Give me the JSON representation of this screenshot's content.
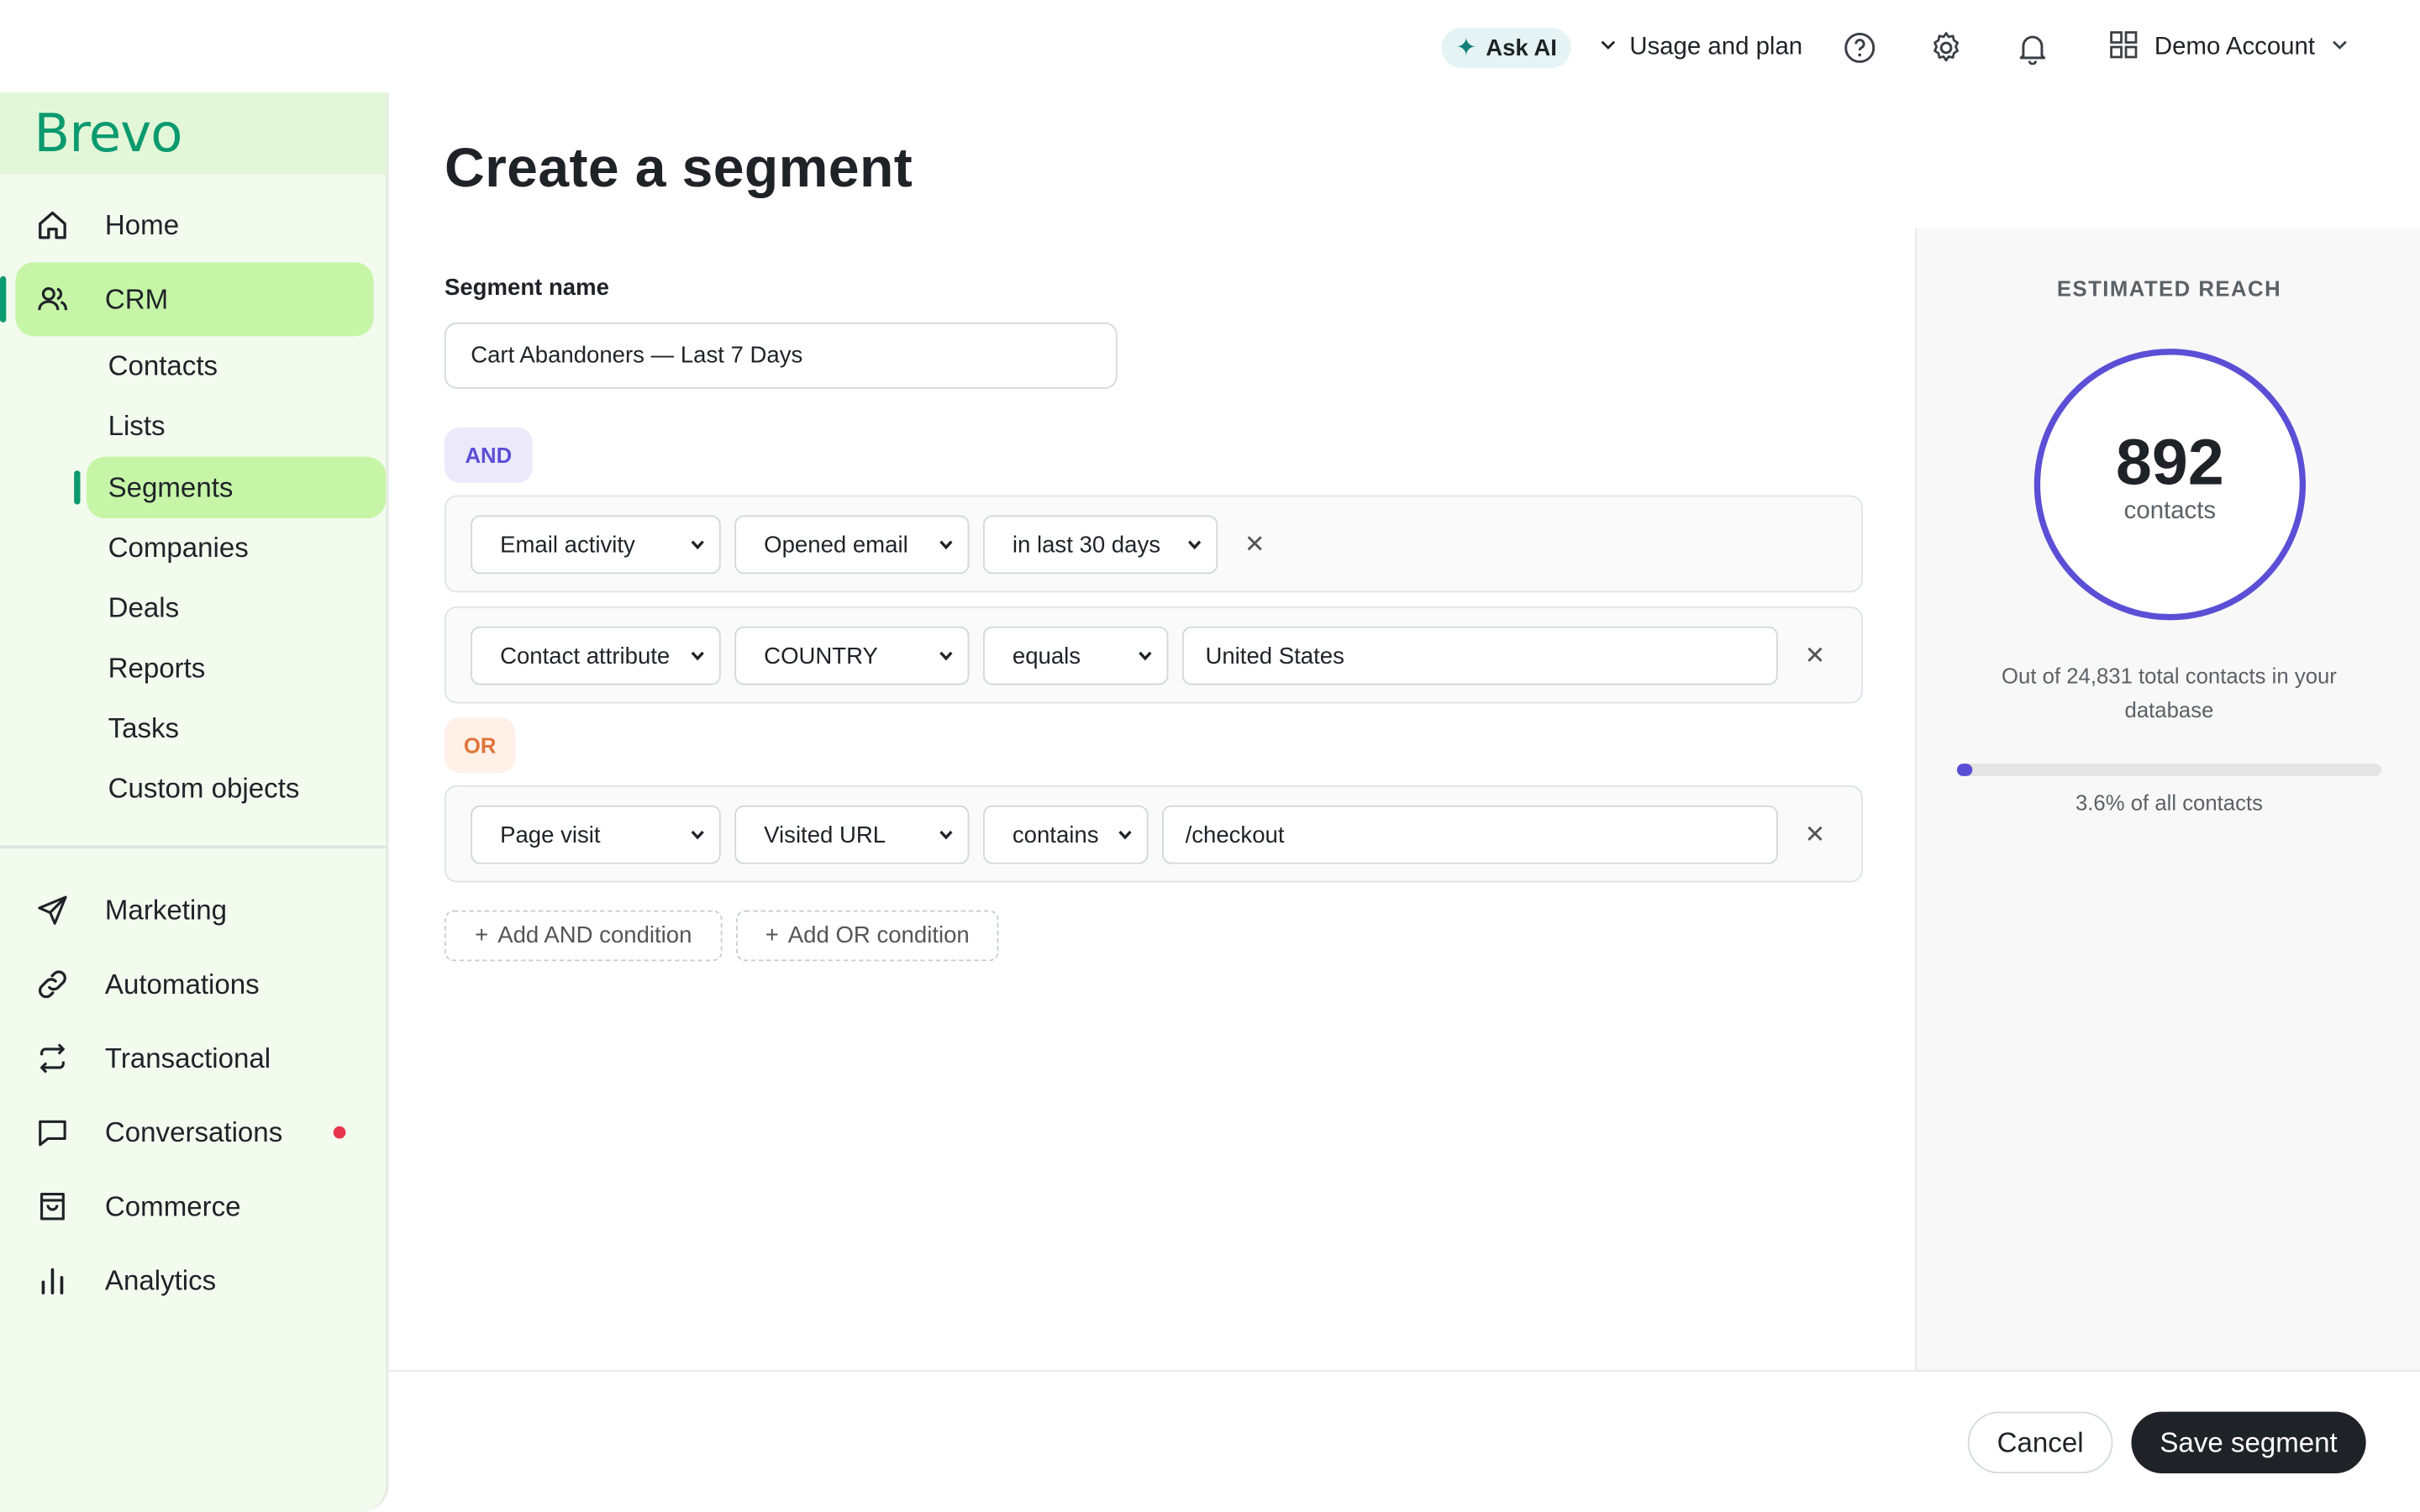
{
  "topbar": {
    "ask_ai": "Ask AI",
    "usage": "Usage and plan",
    "account": "Demo Account"
  },
  "sidebar": {
    "logo": "Brevo",
    "home": "Home",
    "crm": "CRM",
    "crm_items": [
      "Contacts",
      "Lists",
      "Segments",
      "Companies",
      "Deals",
      "Reports",
      "Tasks",
      "Custom objects"
    ],
    "bottom_items": [
      "Marketing",
      "Automations",
      "Transactional",
      "Conversations",
      "Commerce",
      "Analytics"
    ],
    "notification_dot_color": "#e8344e"
  },
  "main": {
    "title": "Create a segment",
    "segment_name_label": "Segment name",
    "segment_name_value": "Cart Abandoners — Last 7 Days",
    "and_label": "AND",
    "or_label": "OR",
    "conditions": [
      {
        "category": "Email activity",
        "field": "Opened email",
        "operator": "in last 30 days",
        "value": ""
      },
      {
        "category": "Contact attribute",
        "field": "COUNTRY",
        "operator": "equals",
        "value": "United States"
      },
      {
        "category": "Page visit",
        "field": "Visited URL",
        "operator": "contains",
        "value": "/checkout"
      }
    ],
    "add_and": "Add AND condition",
    "add_or": "Add OR condition"
  },
  "reach": {
    "title": "ESTIMATED REACH",
    "count": "892",
    "count_label": "contacts",
    "description": "Out of 24,831 total contacts in your database",
    "percent_text": "3.6% of all contacts",
    "percent_value": 3.6
  },
  "footer": {
    "cancel": "Cancel",
    "save": "Save segment"
  },
  "colors": {
    "brand_green": "#0b9a6f",
    "active_nav": "#c6f5a8",
    "accent_purple": "#5b4fd6",
    "or_orange": "#e0753a"
  }
}
